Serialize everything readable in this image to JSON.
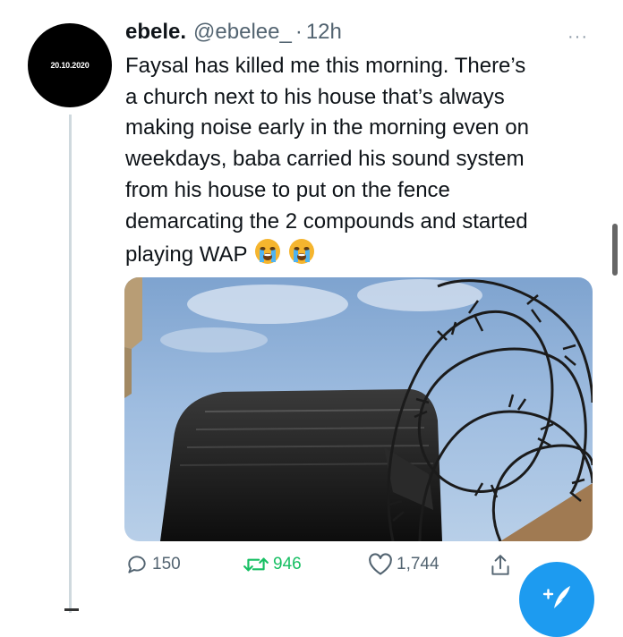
{
  "user": {
    "avatar_text": "20.10.2020",
    "display_name": "ebele.",
    "handle": "@ebelee_",
    "separator": "·",
    "time": "12h"
  },
  "more_label": "···",
  "tweet": {
    "lines": [
      "Faysal has killed me this morning. There’s",
      "a church next to his house that’s always",
      "making noise early in the morning even on",
      "weekdays, baba carried his sound system",
      "from his house to put on the fence",
      "demarcating the 2 compounds and started",
      "playing WAP"
    ],
    "emojis": [
      "loudly-crying-face-emoji",
      "loudly-crying-face-emoji"
    ]
  },
  "media": {
    "description_icon": "speaker-and-barbed-wire-photo"
  },
  "actions": {
    "reply_count": "150",
    "retweet_count": "946",
    "like_count": "1,744"
  },
  "colors": {
    "retweeted": "#17bf63",
    "muted": "#536471",
    "accent": "#1d9bf0"
  },
  "icons": {
    "reply": "speech-bubble-icon",
    "retweet": "retweet-icon",
    "like": "heart-icon",
    "share": "share-icon",
    "compose": "compose-tweet-icon"
  }
}
